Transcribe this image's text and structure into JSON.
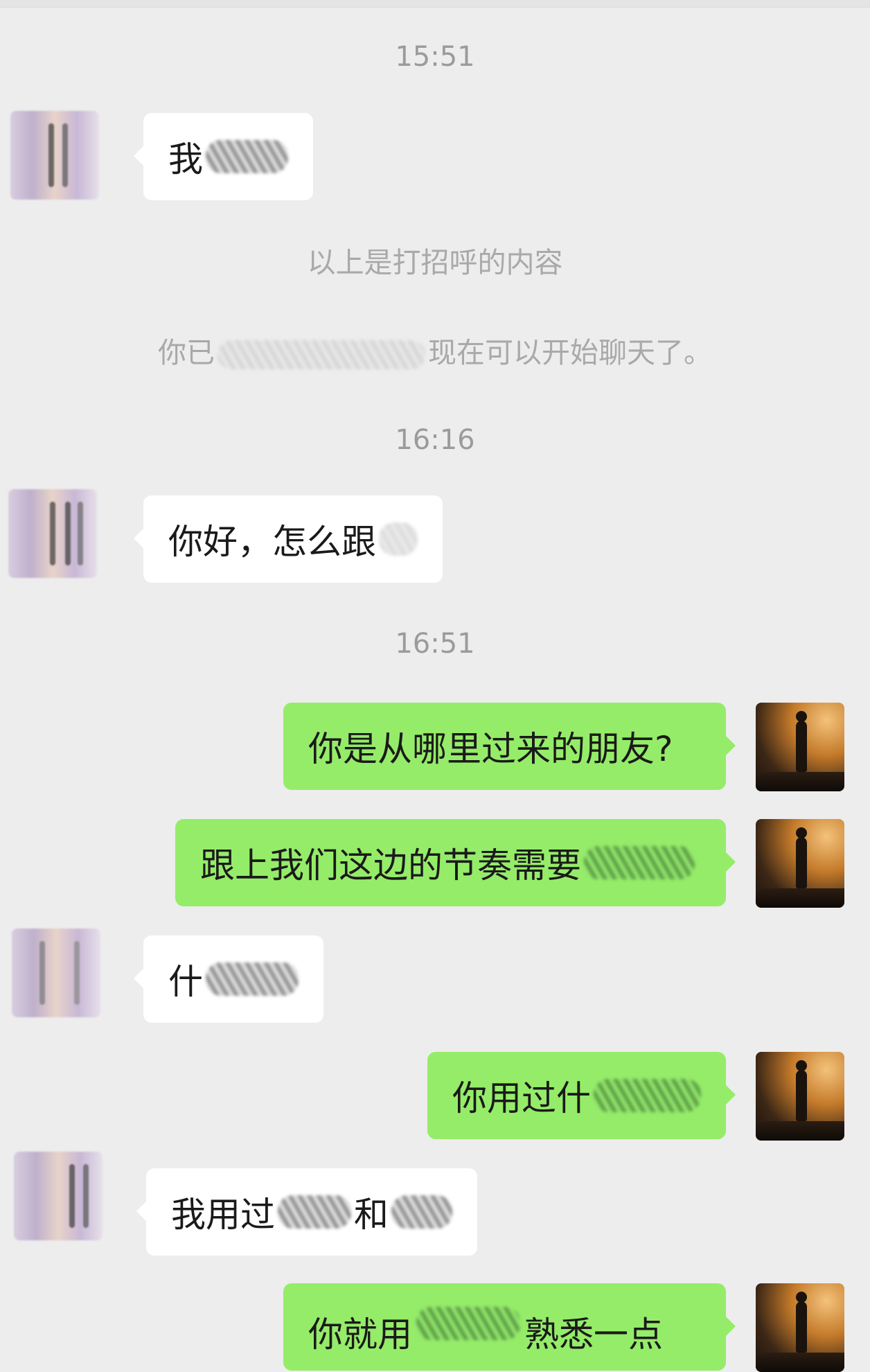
{
  "chat": {
    "time_1": "15:51",
    "msg_1_text": "我",
    "system_1": "以上是打招呼的内容",
    "system_2_prefix": "你已",
    "system_2_suffix": "现在可以开始聊天了。",
    "time_2": "16:16",
    "msg_2_text": "你好，怎么跟",
    "time_3": "16:51",
    "msg_3_text": "你是从哪里过来的朋友?",
    "msg_4_text": "跟上我们这边的节奏需要",
    "msg_5_text": "什",
    "msg_6_text": "你用过什",
    "msg_7_text_a": "我用过",
    "msg_7_text_b": "和",
    "msg_8_text_a": "你就用",
    "msg_8_text_b": "熟悉一点"
  },
  "colors": {
    "background": "#ededed",
    "incoming_bubble": "#ffffff",
    "outgoing_bubble": "#95ec69",
    "system_text": "#a9a9a9"
  }
}
